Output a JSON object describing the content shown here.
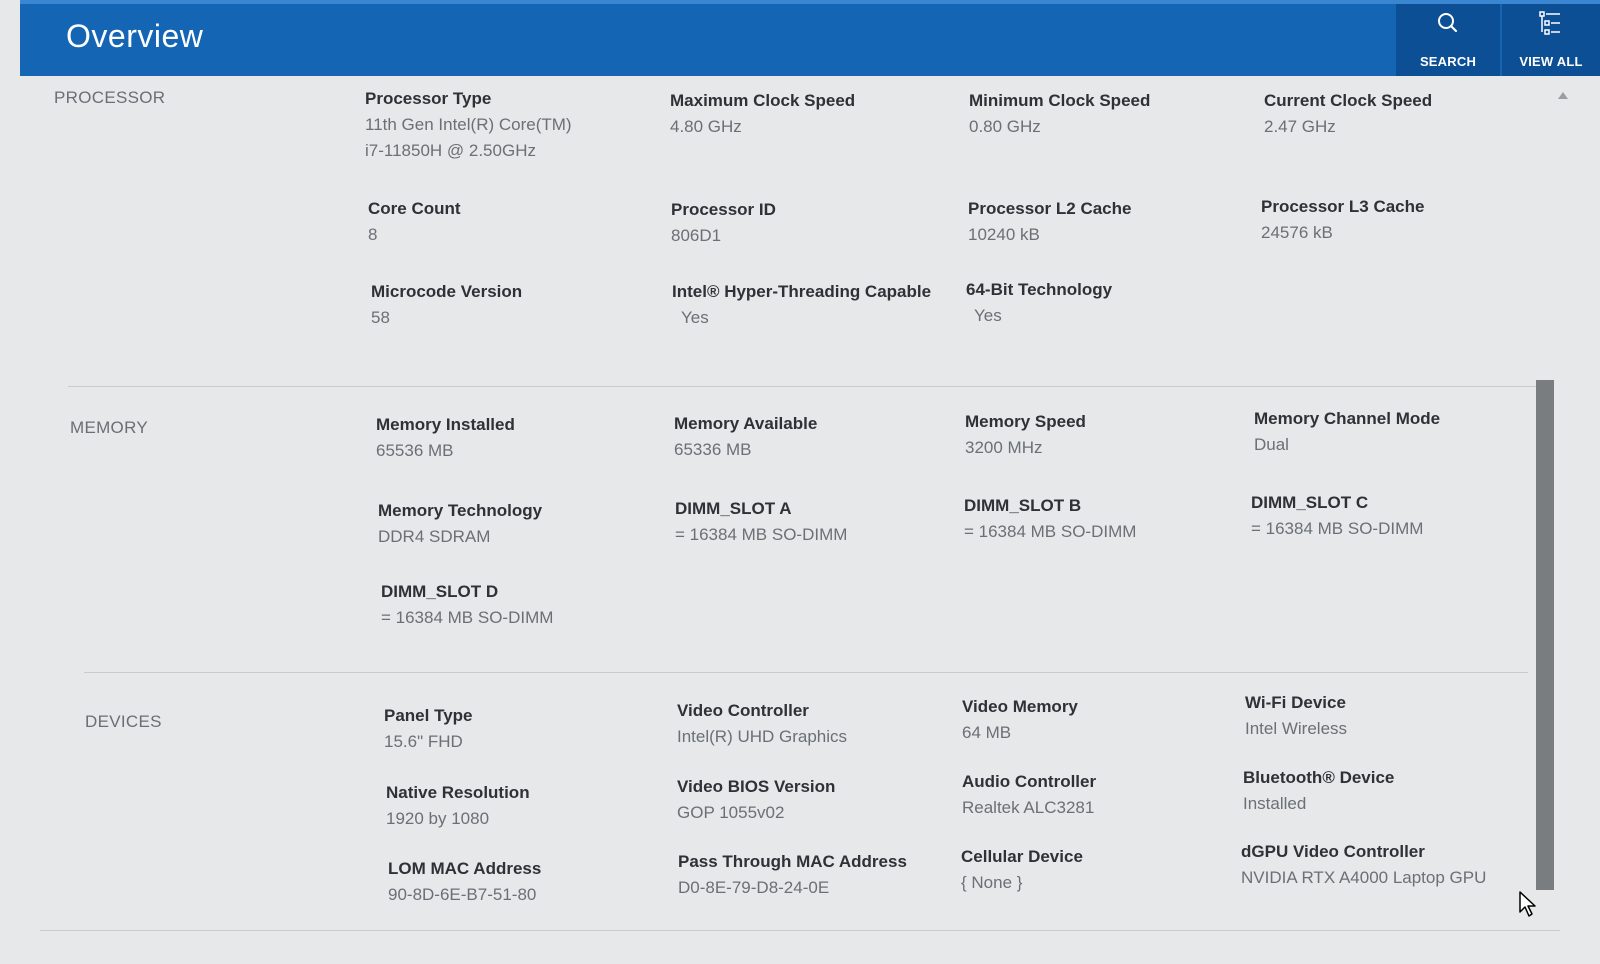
{
  "header": {
    "title": "Overview",
    "search_label": "SEARCH",
    "viewall_label": "VIEW ALL",
    "accent_color": "#1565b5"
  },
  "processor": {
    "label": "PROCESSOR",
    "fields": [
      {
        "key": "Processor Type",
        "value": "11th Gen Intel(R) Core(TM)",
        "value2": "i7-11850H @ 2.50GHz"
      },
      {
        "key": "Maximum Clock Speed",
        "value": "4.80 GHz"
      },
      {
        "key": "Minimum Clock Speed",
        "value": "0.80 GHz"
      },
      {
        "key": "Current Clock Speed",
        "value": "2.47 GHz"
      },
      {
        "key": "Core Count",
        "value": "8"
      },
      {
        "key": "Processor ID",
        "value": "806D1"
      },
      {
        "key": "Processor L2 Cache",
        "value": "10240 kB"
      },
      {
        "key": "Processor L3 Cache",
        "value": "24576 kB"
      },
      {
        "key": "Microcode Version",
        "value": "58"
      },
      {
        "key": "Intel® Hyper-Threading Capable",
        "value": "Yes"
      },
      {
        "key": "64-Bit Technology",
        "value": "Yes"
      }
    ]
  },
  "memory": {
    "label": "MEMORY",
    "fields": [
      {
        "key": "Memory Installed",
        "value": "65536 MB"
      },
      {
        "key": "Memory Available",
        "value": "65336 MB"
      },
      {
        "key": "Memory Speed",
        "value": "3200 MHz"
      },
      {
        "key": "Memory Channel Mode",
        "value": "Dual"
      },
      {
        "key": "Memory Technology",
        "value": "DDR4 SDRAM"
      },
      {
        "key": "DIMM_SLOT A",
        "value": "= 16384 MB SO-DIMM"
      },
      {
        "key": "DIMM_SLOT B",
        "value": "= 16384 MB SO-DIMM"
      },
      {
        "key": "DIMM_SLOT C",
        "value": "= 16384 MB SO-DIMM"
      },
      {
        "key": "DIMM_SLOT D",
        "value": "= 16384 MB SO-DIMM"
      }
    ]
  },
  "devices": {
    "label": "DEVICES",
    "fields": [
      {
        "key": "Panel Type",
        "value": "15.6\" FHD"
      },
      {
        "key": "Video Controller",
        "value": "Intel(R) UHD Graphics"
      },
      {
        "key": "Video Memory",
        "value": "64 MB"
      },
      {
        "key": "Wi-Fi Device",
        "value": "Intel Wireless"
      },
      {
        "key": "Native Resolution",
        "value": "1920 by 1080"
      },
      {
        "key": "Video BIOS Version",
        "value": "GOP 1055v02"
      },
      {
        "key": "Audio Controller",
        "value": "Realtek ALC3281"
      },
      {
        "key": "Bluetooth® Device",
        "value": "Installed"
      },
      {
        "key": "LOM MAC Address",
        "value": "90-8D-6E-B7-51-80"
      },
      {
        "key": "Pass Through MAC Address",
        "value": "D0-8E-79-D8-24-0E"
      },
      {
        "key": "Cellular Device",
        "value": "{ None }"
      },
      {
        "key": "dGPU Video Controller",
        "value": "NVIDIA RTX A4000 Laptop GPU"
      }
    ]
  }
}
